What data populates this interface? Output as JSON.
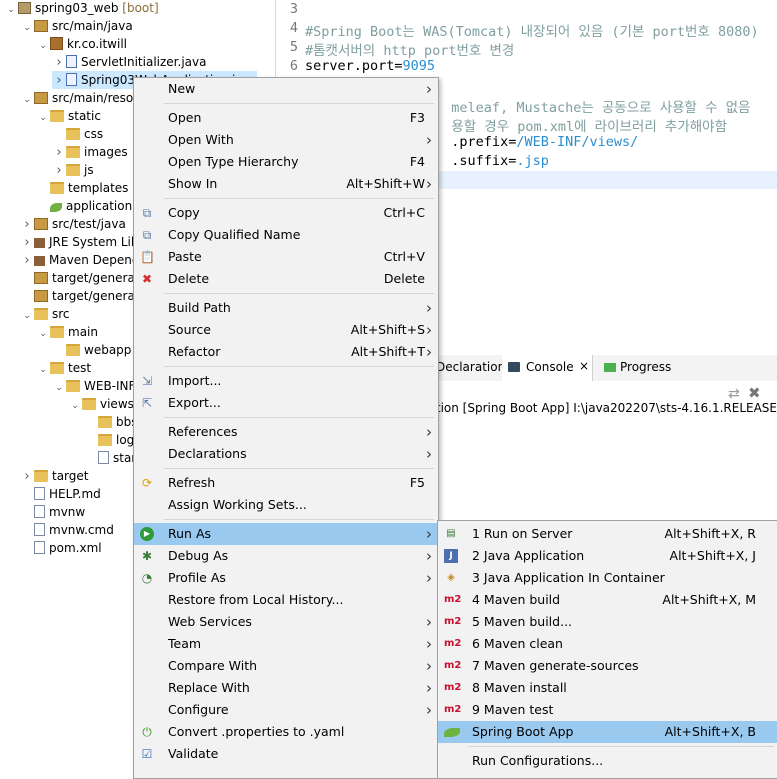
{
  "tree": [
    {
      "label": "spring03_web",
      "suffix": " [boot]",
      "icon": "project-icon",
      "tw": "v"
    },
    {
      "label": "src/main/java",
      "icon": "source-folder-icon",
      "tw": "v"
    },
    {
      "label": "kr.co.itwill",
      "icon": "package-icon",
      "tw": "v"
    },
    {
      "label": "ServletInitializer.java",
      "icon": "java-file-icon",
      "tw": ">"
    },
    {
      "label": "Spring03WebApplication.java",
      "icon": "java-file-icon",
      "tw": ">"
    },
    {
      "label": "src/main/resources",
      "icon": "source-folder-icon",
      "tw": "v"
    },
    {
      "label": "static",
      "icon": "folder-icon",
      "tw": "v"
    },
    {
      "label": "css",
      "icon": "folder-icon",
      "tw": ""
    },
    {
      "label": "images",
      "icon": "folder-icon",
      "tw": ">"
    },
    {
      "label": "js",
      "icon": "folder-icon",
      "tw": ">"
    },
    {
      "label": "templates",
      "icon": "folder-icon",
      "tw": ""
    },
    {
      "label": "application.properties",
      "icon": "properties-file-icon",
      "tw": ""
    },
    {
      "label": "src/test/java",
      "icon": "source-folder-icon",
      "tw": ">"
    },
    {
      "label": "JRE System Library",
      "icon": "library-icon",
      "tw": ">"
    },
    {
      "label": "Maven Dependencies",
      "icon": "library-icon",
      "tw": ">"
    },
    {
      "label": "target/generated-sources",
      "icon": "source-folder-icon",
      "tw": ""
    },
    {
      "label": "target/generated-test-sources",
      "icon": "source-folder-icon",
      "tw": ""
    },
    {
      "label": "src",
      "icon": "folder-icon",
      "tw": "v"
    },
    {
      "label": "main",
      "icon": "folder-icon",
      "tw": "v"
    },
    {
      "label": "webapp",
      "icon": "folder-icon",
      "tw": ""
    },
    {
      "label": "test",
      "icon": "folder-icon",
      "tw": "v"
    },
    {
      "label": "WEB-INF",
      "icon": "folder-icon",
      "tw": "v"
    },
    {
      "label": "views",
      "icon": "folder-icon",
      "tw": "v"
    },
    {
      "label": "bbs",
      "icon": "folder-icon",
      "tw": ""
    },
    {
      "label": "log",
      "icon": "folder-icon",
      "tw": ""
    },
    {
      "label": "start",
      "icon": "file-icon",
      "tw": ""
    },
    {
      "label": "target",
      "icon": "folder-icon",
      "tw": ">"
    },
    {
      "label": "HELP.md",
      "icon": "file-icon",
      "tw": ""
    },
    {
      "label": "mvnw",
      "icon": "file-icon",
      "tw": ""
    },
    {
      "label": "mvnw.cmd",
      "icon": "file-icon",
      "tw": ""
    },
    {
      "label": "pom.xml",
      "icon": "xml-file-icon",
      "tw": ""
    }
  ],
  "editor": {
    "lines": [
      {
        "n": "3",
        "parts": []
      },
      {
        "n": "4",
        "parts": [
          {
            "t": "#Spring Boot는 WAS(Tomcat) 내장되어 있음 (기본 port번호 8080)",
            "c": "cmt"
          }
        ]
      },
      {
        "n": "5",
        "parts": [
          {
            "t": "#톰캣서버의 http port번호 변경",
            "c": "cmt"
          }
        ]
      },
      {
        "n": "6",
        "parts": [
          {
            "t": "server.port=",
            "c": "key"
          },
          {
            "t": "9095",
            "c": "val"
          }
        ]
      },
      {
        "n": "",
        "parts": []
      },
      {
        "n": "",
        "parts": [
          {
            "t": "                  meleaf, Mustache는 공동으로 사용할 수 없음",
            "c": "cmt"
          }
        ]
      },
      {
        "n": "",
        "parts": [
          {
            "t": "                  용할 경우 pom.xml에 라이브러리 추가해야함",
            "c": "cmt"
          }
        ]
      },
      {
        "n": "",
        "parts": [
          {
            "t": "                  .prefix=",
            "c": "key"
          },
          {
            "t": "/WEB-INF/views/",
            "c": "val"
          }
        ]
      },
      {
        "n": "",
        "parts": [
          {
            "t": "                  .suffix=",
            "c": "key"
          },
          {
            "t": ".jsp",
            "c": "val"
          }
        ]
      }
    ]
  },
  "views": {
    "declaration_tab": "Declaration",
    "console_tab": "Console",
    "progress_tab": "Progress",
    "console_line": "<terminated> Application [Spring Boot App] I:\\java202207\\sts-4.16.1.RELEASE"
  },
  "context_menu": [
    {
      "label": "New",
      "sc": "",
      "arrow": true,
      "icon": ""
    },
    {
      "sep": true
    },
    {
      "label": "Open",
      "sc": "F3",
      "arrow": false,
      "icon": ""
    },
    {
      "label": "Open With",
      "sc": "",
      "arrow": true,
      "icon": ""
    },
    {
      "label": "Open Type Hierarchy",
      "sc": "F4",
      "arrow": false,
      "icon": ""
    },
    {
      "label": "Show In",
      "sc": "Alt+Shift+W",
      "arrow": true,
      "icon": ""
    },
    {
      "sep": true
    },
    {
      "label": "Copy",
      "sc": "Ctrl+C",
      "arrow": false,
      "icon": "copy-icon"
    },
    {
      "label": "Copy Qualified Name",
      "sc": "",
      "arrow": false,
      "icon": "copy-qualified-icon"
    },
    {
      "label": "Paste",
      "sc": "Ctrl+V",
      "arrow": false,
      "icon": "paste-icon"
    },
    {
      "label": "Delete",
      "sc": "Delete",
      "arrow": false,
      "icon": "delete-icon"
    },
    {
      "sep": true
    },
    {
      "label": "Build Path",
      "sc": "",
      "arrow": true,
      "icon": ""
    },
    {
      "label": "Source",
      "sc": "Alt+Shift+S",
      "arrow": true,
      "icon": ""
    },
    {
      "label": "Refactor",
      "sc": "Alt+Shift+T",
      "arrow": true,
      "icon": ""
    },
    {
      "sep": true
    },
    {
      "label": "Import...",
      "sc": "",
      "arrow": false,
      "icon": "import-icon"
    },
    {
      "label": "Export...",
      "sc": "",
      "arrow": false,
      "icon": "export-icon"
    },
    {
      "sep": true
    },
    {
      "label": "References",
      "sc": "",
      "arrow": true,
      "icon": ""
    },
    {
      "label": "Declarations",
      "sc": "",
      "arrow": true,
      "icon": ""
    },
    {
      "sep": true
    },
    {
      "label": "Refresh",
      "sc": "F5",
      "arrow": false,
      "icon": "refresh-icon"
    },
    {
      "label": "Assign Working Sets...",
      "sc": "",
      "arrow": false,
      "icon": ""
    },
    {
      "sep": true
    },
    {
      "label": "Run As",
      "sc": "",
      "arrow": true,
      "icon": "run-icon",
      "hl": true
    },
    {
      "label": "Debug As",
      "sc": "",
      "arrow": true,
      "icon": "debug-icon"
    },
    {
      "label": "Profile As",
      "sc": "",
      "arrow": true,
      "icon": "profile-icon"
    },
    {
      "label": "Restore from Local History...",
      "sc": "",
      "arrow": false,
      "icon": ""
    },
    {
      "label": "Web Services",
      "sc": "",
      "arrow": true,
      "icon": ""
    },
    {
      "label": "Team",
      "sc": "",
      "arrow": true,
      "icon": ""
    },
    {
      "label": "Compare With",
      "sc": "",
      "arrow": true,
      "icon": ""
    },
    {
      "label": "Replace With",
      "sc": "",
      "arrow": true,
      "icon": ""
    },
    {
      "label": "Configure",
      "sc": "",
      "arrow": true,
      "icon": ""
    },
    {
      "label": "Convert .properties to .yaml",
      "sc": "",
      "arrow": false,
      "icon": "spring-power-icon"
    },
    {
      "label": "Validate",
      "sc": "",
      "arrow": false,
      "icon": "validate-check-icon"
    }
  ],
  "run_as_menu": [
    {
      "label": "1 Run on Server",
      "sc": "Alt+Shift+X, R",
      "icon": "server-icon"
    },
    {
      "label": "2 Java Application",
      "sc": "Alt+Shift+X, J",
      "icon": "java-app-icon"
    },
    {
      "label": "3 Java Application In Container",
      "sc": "",
      "icon": "container-icon"
    },
    {
      "label": "4 Maven build",
      "sc": "Alt+Shift+X, M",
      "icon": "maven-icon"
    },
    {
      "label": "5 Maven build...",
      "sc": "",
      "icon": "maven-icon"
    },
    {
      "label": "6 Maven clean",
      "sc": "",
      "icon": "maven-icon"
    },
    {
      "label": "7 Maven generate-sources",
      "sc": "",
      "icon": "maven-icon"
    },
    {
      "label": "8 Maven install",
      "sc": "",
      "icon": "maven-icon"
    },
    {
      "label": "9 Maven test",
      "sc": "",
      "icon": "maven-icon"
    },
    {
      "label": "Spring Boot App",
      "sc": "Alt+Shift+X, B",
      "icon": "spring-leaf-icon",
      "hl": true
    },
    {
      "sep": true
    },
    {
      "label": "Run Configurations...",
      "sc": "",
      "icon": ""
    }
  ],
  "m2_label": "m2"
}
